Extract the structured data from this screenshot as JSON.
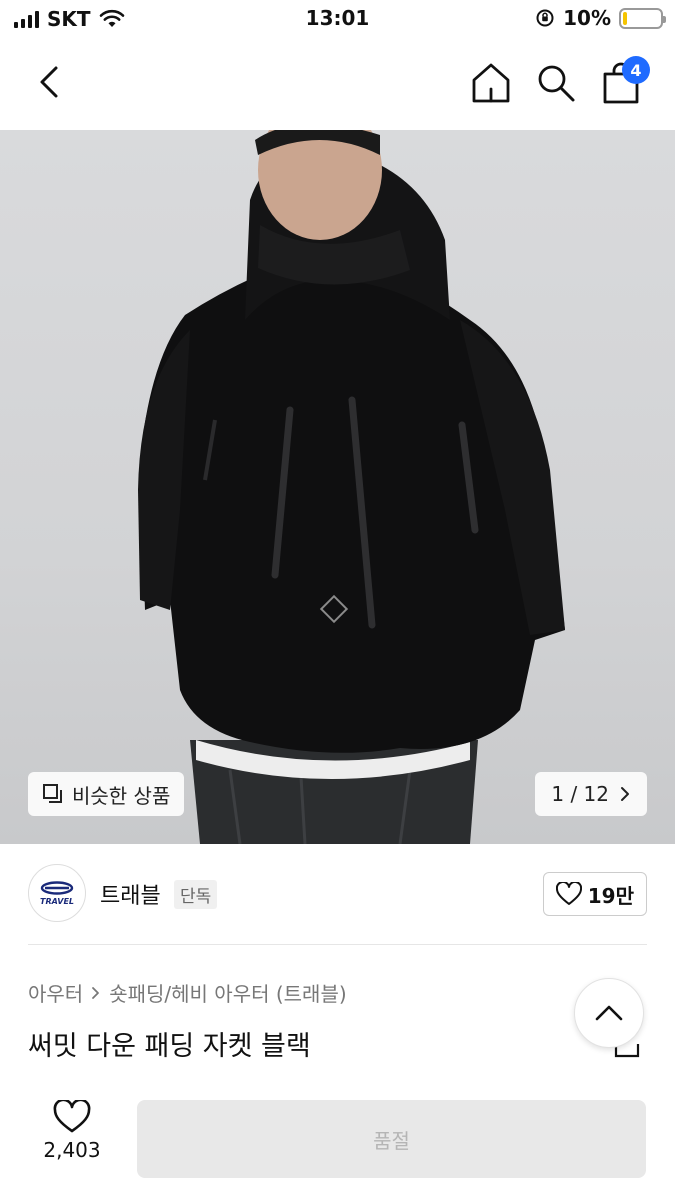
{
  "status_bar": {
    "carrier": "SKT",
    "time": "13:01",
    "battery_percent": "10%",
    "battery_level": 0.1
  },
  "nav": {
    "cart_count": "4",
    "icons": [
      "chevron-left-icon",
      "home-icon",
      "search-icon",
      "shopping-bag-icon"
    ]
  },
  "gallery": {
    "similar_label": "비슷한 상품",
    "page_indicator": "1 / 12"
  },
  "brand": {
    "logo_text": "TRAVEL",
    "name": "트래블",
    "tag": "단독",
    "likes": "19만"
  },
  "breadcrumb": {
    "category": "아우터",
    "subcategory": "숏패딩/헤비 아우터 (트래블)"
  },
  "product": {
    "title": "써밋 다운 패딩 자켓 블랙"
  },
  "bottom_bar": {
    "like_count": "2,403",
    "soldout_label": "품절"
  },
  "colors": {
    "badge": "#1f6bff",
    "battery_fill": "#f5c400",
    "soldout_bg": "#e8e8e8"
  }
}
